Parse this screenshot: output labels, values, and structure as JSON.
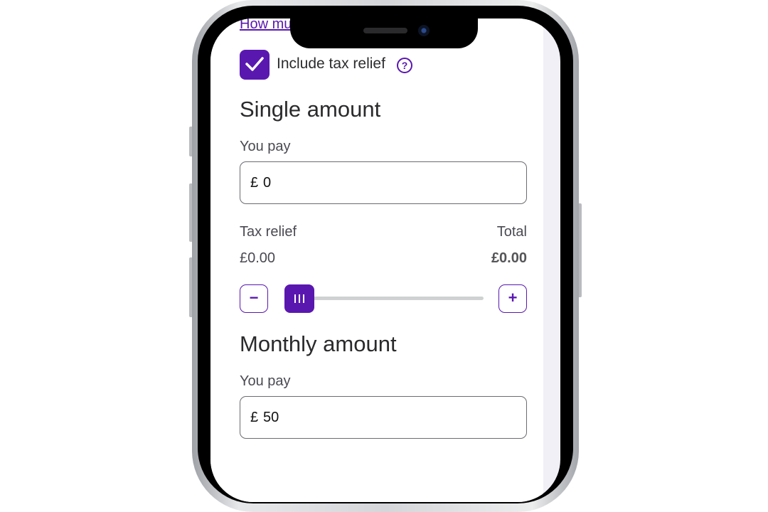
{
  "app": {
    "link_text": "How mu",
    "include_tax_relief": {
      "label": "Include tax relief",
      "checked": true,
      "help_icon": "question-circle-icon"
    },
    "single": {
      "heading": "Single amount",
      "you_pay_label": "You pay",
      "currency": "£",
      "amount": "0",
      "tax_relief_label": "Tax relief",
      "tax_relief_value": "£0.00",
      "total_label": "Total",
      "total_value": "£0.00",
      "decrease_label": "−",
      "increase_label": "+",
      "slider_level": 0
    },
    "monthly": {
      "heading": "Monthly amount",
      "you_pay_label": "You pay",
      "currency": "£",
      "amount": "50"
    }
  },
  "colors": {
    "accent": "#5a17b0",
    "text": "#2a2a2c",
    "muted": "#4a4a52",
    "track": "#cfd1d2"
  }
}
